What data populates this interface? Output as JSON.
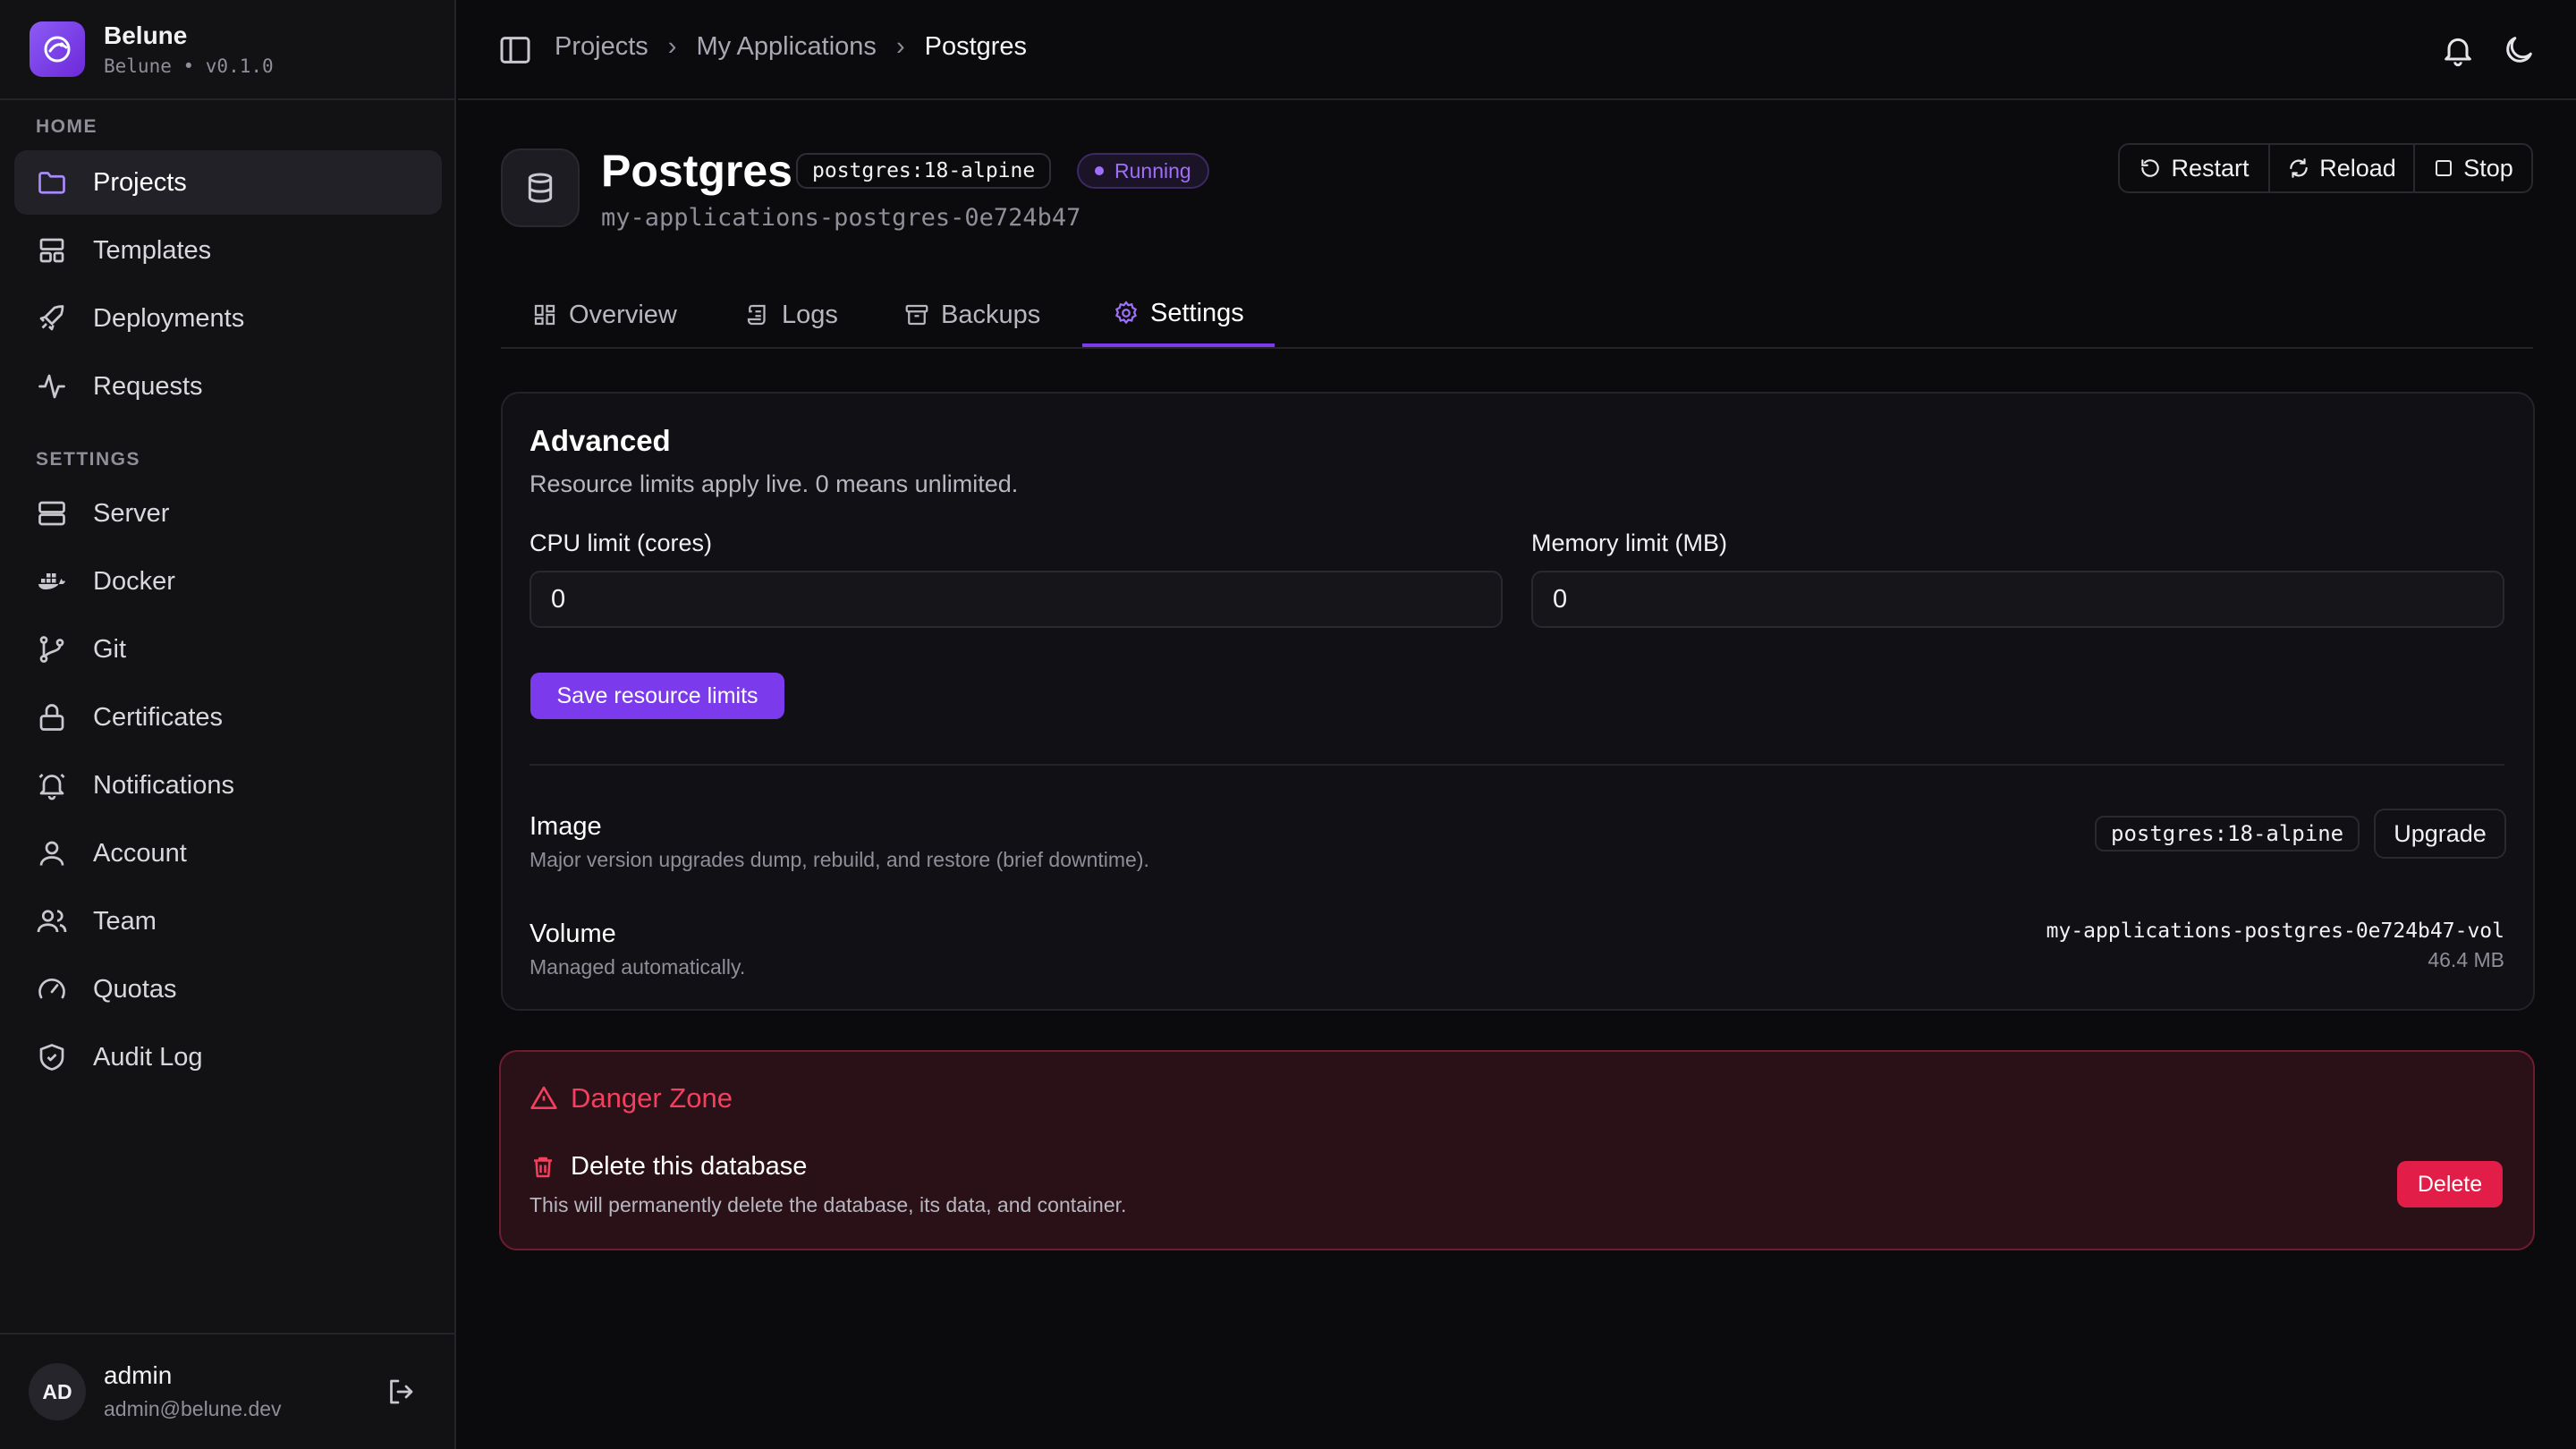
{
  "brand": {
    "name": "Belune",
    "version": "Belune • v0.1.0"
  },
  "nav": {
    "home_label": "HOME",
    "home_items": [
      {
        "label": "Projects",
        "icon": "folder-icon",
        "active": true
      },
      {
        "label": "Templates",
        "icon": "layout-icon"
      },
      {
        "label": "Deployments",
        "icon": "rocket-icon"
      },
      {
        "label": "Requests",
        "icon": "activity-icon"
      }
    ],
    "settings_label": "SETTINGS",
    "settings_items": [
      {
        "label": "Server",
        "icon": "server-icon"
      },
      {
        "label": "Docker",
        "icon": "docker-icon"
      },
      {
        "label": "Git",
        "icon": "git-branch-icon"
      },
      {
        "label": "Certificates",
        "icon": "lock-icon"
      },
      {
        "label": "Notifications",
        "icon": "bell-icon"
      },
      {
        "label": "Account",
        "icon": "user-icon"
      },
      {
        "label": "Team",
        "icon": "users-icon"
      },
      {
        "label": "Quotas",
        "icon": "gauge-icon"
      },
      {
        "label": "Audit Log",
        "icon": "shield-check-icon"
      }
    ]
  },
  "user": {
    "initials": "AD",
    "name": "admin",
    "email": "admin@belune.dev"
  },
  "breadcrumb": [
    "Projects",
    "My Applications",
    "Postgres"
  ],
  "service": {
    "name": "Postgres",
    "image": "postgres:18-alpine",
    "status": "Running",
    "container": "my-applications-postgres-0e724b47"
  },
  "actions": {
    "restart": "Restart",
    "reload": "Reload",
    "stop": "Stop"
  },
  "tabs": [
    "Overview",
    "Logs",
    "Backups",
    "Settings"
  ],
  "active_tab": "Settings",
  "advanced": {
    "title": "Advanced",
    "description": "Resource limits apply live. 0 means unlimited.",
    "cpu_label": "CPU limit (cores)",
    "cpu_value": "0",
    "memory_label": "Memory limit (MB)",
    "memory_value": "0",
    "save_label": "Save resource limits"
  },
  "image_section": {
    "title": "Image",
    "description": "Major version upgrades dump, rebuild, and restore (brief downtime).",
    "value": "postgres:18-alpine",
    "upgrade_label": "Upgrade"
  },
  "volume_section": {
    "title": "Volume",
    "description": "Managed automatically.",
    "name": "my-applications-postgres-0e724b47-vol",
    "size": "46.4 MB"
  },
  "danger": {
    "title": "Danger Zone",
    "delete_title": "Delete this database",
    "delete_desc": "This will permanently delete the database, its data, and container.",
    "delete_label": "Delete"
  },
  "colors": {
    "accent": "#7c3aed",
    "danger": "#e11d48",
    "background": "#0b0a0d"
  }
}
